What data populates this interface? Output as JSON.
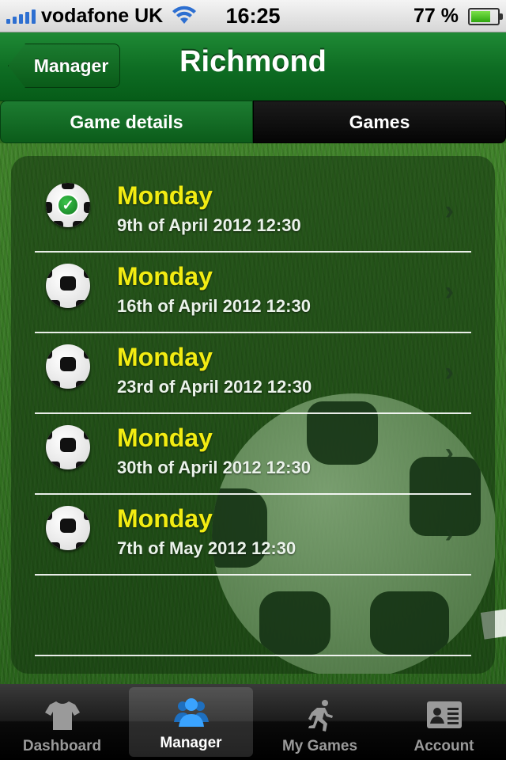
{
  "status_bar": {
    "carrier": "vodafone UK",
    "time": "16:25",
    "battery": "77 %",
    "signal_icon": "signal-bars-icon",
    "wifi_icon": "wifi-icon",
    "battery_icon": "battery-icon"
  },
  "nav": {
    "back_label": "Manager",
    "title": "Richmond"
  },
  "segments": {
    "details": "Game details",
    "games": "Games",
    "selected": "Game details"
  },
  "games": [
    {
      "day": "Monday",
      "date": "9th of April 2012 12:30",
      "status": "confirmed"
    },
    {
      "day": "Monday",
      "date": "16th of April 2012 12:30",
      "status": "pending"
    },
    {
      "day": "Monday",
      "date": "23rd of April 2012 12:30",
      "status": "pending"
    },
    {
      "day": "Monday",
      "date": "30th of April 2012 12:30",
      "status": "pending"
    },
    {
      "day": "Monday",
      "date": "7th of May 2012 12:30",
      "status": "pending"
    }
  ],
  "tabbar": {
    "items": [
      {
        "label": "Dashboard",
        "icon": "shirt-icon"
      },
      {
        "label": "Manager",
        "icon": "people-icon"
      },
      {
        "label": "My Games",
        "icon": "runner-icon"
      },
      {
        "label": "Account",
        "icon": "id-card-icon"
      }
    ],
    "active": "Manager"
  },
  "colors": {
    "accent_green": "#0f6e24",
    "day_yellow": "#f2ec12",
    "manager_blue": "#3aa3ff"
  }
}
